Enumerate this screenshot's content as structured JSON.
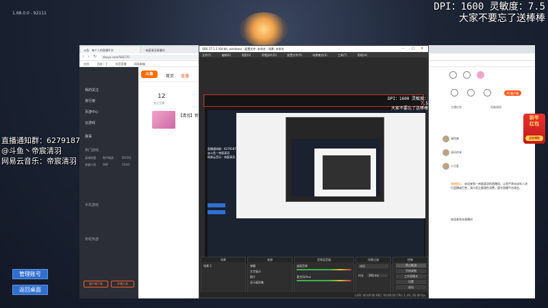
{
  "desktop": {
    "version": "1.68.0.0 - 92111",
    "overlay_top_right": [
      "DPI：1600 灵敏度：7.5",
      "大家不要忘了送棒棒"
    ],
    "overlay_left": [
      "直播通知群：627918776",
      "@斗鱼丶帝宸清羽",
      "网易云音乐：帝宸清羽"
    ],
    "buttons": [
      "管理账号",
      "返回桌面"
    ]
  },
  "browser": {
    "tabs": [
      "斗鱼 · 每个人的直播平台",
      "· 帝宸清羽直播间"
    ],
    "url": "douyu.com/566770",
    "bookmarks": [
      "应用",
      "百度一下",
      "抖音直播",
      "网易邮箱"
    ],
    "nav": [
      "首页",
      "直播"
    ],
    "sidebar": {
      "items": [
        "我的关注",
        "排行榜",
        "页游中心",
        "云游戏",
        "赛事"
      ],
      "section_hot": "热门游戏",
      "hot_games": [
        "英雄联盟",
        "和平精英",
        "DOTA2",
        "穿越火线",
        "DNF",
        "CSGO"
      ],
      "section_mobile": "手机游戏",
      "section_single": "单机热游",
      "buttons": [
        "客户端下载",
        "开播工具"
      ]
    },
    "card": {
      "count": "12",
      "sub": "关注主播",
      "title": "【清羽】新"
    },
    "right": {
      "pc_label": "PC客户端",
      "tabs": [
        "主播任务",
        "贡献周榜"
      ],
      "users": [
        "薄荷酱",
        "清风徐来",
        "小可爱"
      ],
      "notice_label": "系统提示：",
      "notice": "欢迎来到一帝宸清羽的直播间，斗鱼严禁未成年人进行直播或打赏，请大家注意理性消费，遵守直播平台规定。",
      "welcome_label": "欢迎来到本直播间",
      "promo": [
        "新年",
        "红包",
        "点击领取"
      ]
    }
  },
  "obs": {
    "title": "OBS 27.1.3 (64-bit, windows) - 配置文件: 未命名 - 场景: 未命名",
    "menu": [
      "文件(F)",
      "编辑(E)",
      "视图(V)",
      "停靠部件(D)",
      "配置文件(P)",
      "场景集合(S)",
      "工具(T)",
      "帮助(H)"
    ],
    "preview_overlay_right": [
      "DPI：1600 灵敏度：7.5",
      "大家不要忘了送棒棒"
    ],
    "preview_overlay_left": [
      "直播通知群：627918776",
      "@斗鱼丶帝宸清羽",
      "网易云音乐：帝宸清羽"
    ],
    "docks": {
      "scenes": {
        "title": "场景",
        "items": [
          "场景 2"
        ]
      },
      "sources": {
        "title": "来源",
        "items": [
          "弹幕",
          "文字展示",
          "图片",
          "显示器采集"
        ]
      },
      "mixer": {
        "title": "音频混音器",
        "items": [
          "桌面音频",
          "麦克风/Aux"
        ]
      },
      "transitions": {
        "title": "场景过渡",
        "mode": "淡出",
        "duration_label": "时长",
        "duration": "300 ms"
      },
      "controls": {
        "title": "控制",
        "buttons": [
          "停止推流",
          "开始录制",
          "工作室模式",
          "设置",
          "退出"
        ]
      }
    },
    "status": "LIVE: 00:00:00  REC: 00:00:00  CPU: 1.3%, 60.00 fps"
  }
}
